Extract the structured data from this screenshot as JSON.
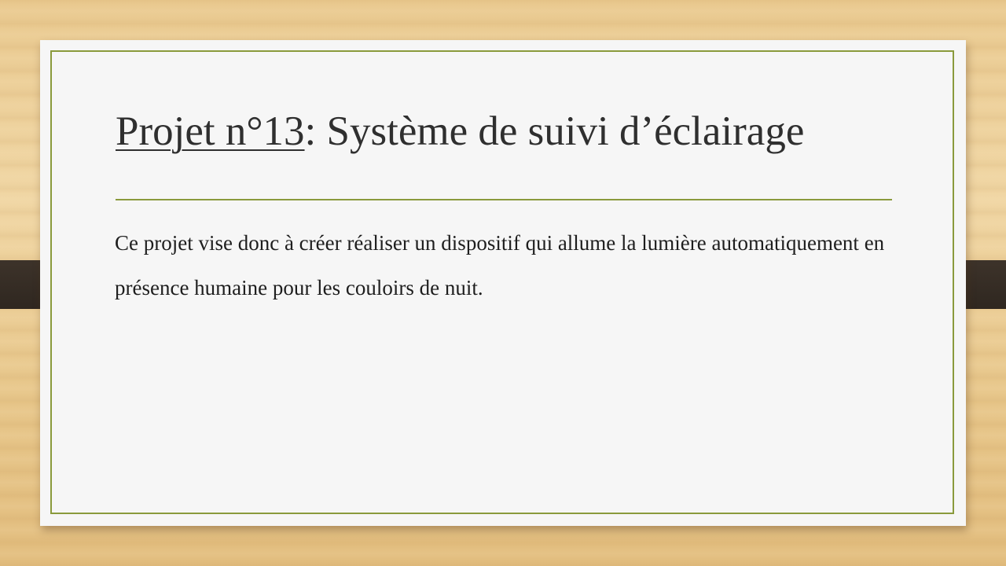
{
  "slide": {
    "title_prefix": "Projet n°13",
    "title_rest": ": Système de suivi d’éclairage",
    "body": "Ce projet vise donc à créer réaliser un dispositif qui allume la lumière automatiquement en présence humaine pour les couloirs de nuit."
  },
  "colors": {
    "accent": "#8a9a3c",
    "strap": "#3d332a",
    "card": "#f6f6f6",
    "text": "#2f2f2f"
  }
}
